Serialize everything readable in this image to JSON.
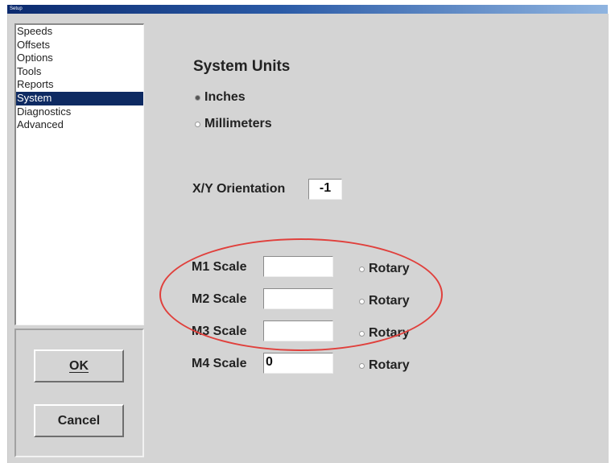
{
  "window": {
    "title": "Setup"
  },
  "nav": {
    "items": [
      "Speeds",
      "Offsets",
      "Options",
      "Tools",
      "Reports",
      "System",
      "Diagnostics",
      "Advanced"
    ],
    "selected": "System"
  },
  "buttons": {
    "ok": "OK",
    "cancel": "Cancel"
  },
  "system_units": {
    "title": "System Units",
    "options": [
      "Inches",
      "Millimeters"
    ],
    "selected": "Inches"
  },
  "orientation": {
    "label": "X/Y Orientation",
    "value": "-1"
  },
  "scales": [
    {
      "label": "M1 Scale",
      "value": "",
      "rotary_label": "Rotary"
    },
    {
      "label": "M2 Scale",
      "value": "",
      "rotary_label": "Rotary"
    },
    {
      "label": "M3 Scale",
      "value": "",
      "rotary_label": "Rotary"
    },
    {
      "label": "M4 Scale",
      "value": "0",
      "rotary_label": "Rotary"
    }
  ],
  "colors": {
    "selection": "#0e2a62",
    "annotation": "#e0403c",
    "window_bg": "#d4d4d4"
  }
}
